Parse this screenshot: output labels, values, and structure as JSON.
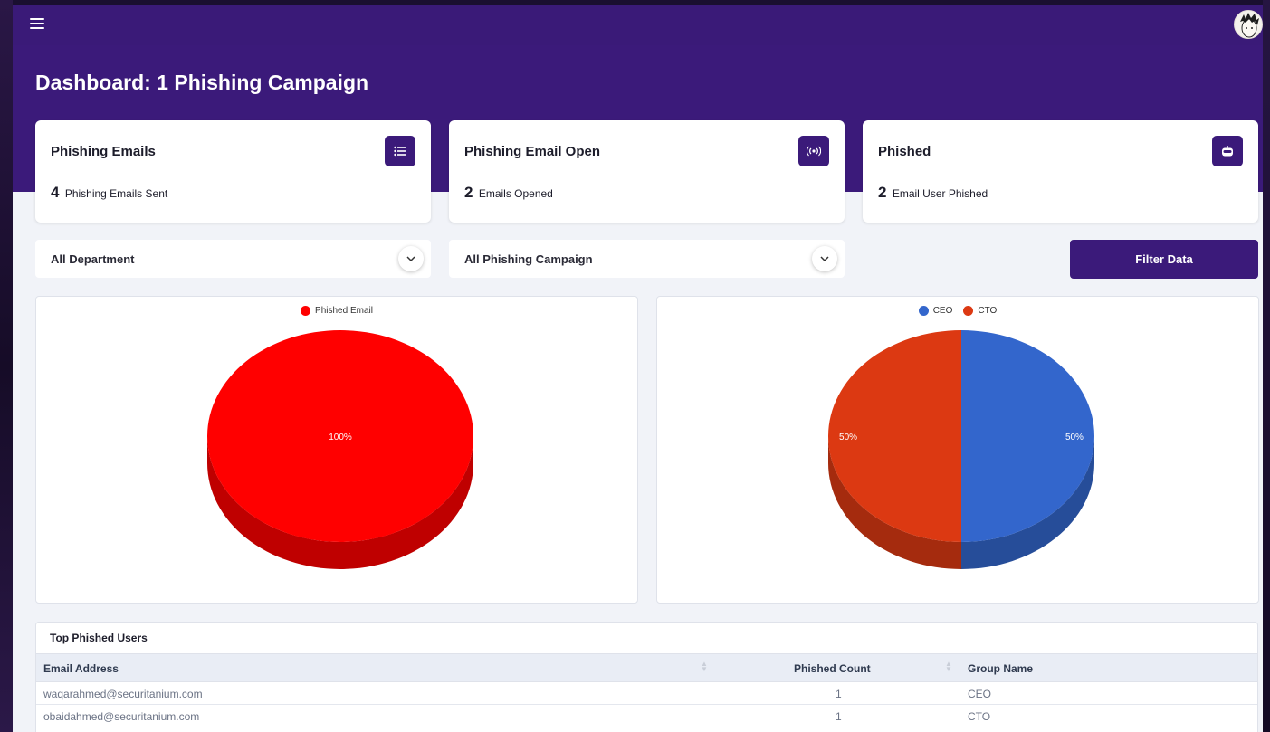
{
  "header": {
    "page_title": "Dashboard: 1 Phishing Campaign"
  },
  "cards": [
    {
      "title": "Phishing Emails",
      "value": "4",
      "label": "Phishing Emails Sent",
      "icon": "list-icon"
    },
    {
      "title": "Phishing Email Open",
      "value": "2",
      "label": "Emails Opened",
      "icon": "broadcast-icon"
    },
    {
      "title": "Phished",
      "value": "2",
      "label": "Email User Phished",
      "icon": "robot-icon"
    }
  ],
  "filters": {
    "department": "All Department",
    "campaign": "All Phishing Campaign",
    "filter_button": "Filter Data"
  },
  "colors": {
    "primary": "#3b1a7a",
    "phished": "#ff0000",
    "ceo": "#3366cc",
    "cto": "#dc3912"
  },
  "chart_data": [
    {
      "type": "pie",
      "legend": [
        "Phished Email"
      ],
      "slices": [
        {
          "name": "Phished Email",
          "value": 100,
          "label": "100%",
          "color": "#ff0000"
        }
      ]
    },
    {
      "type": "pie",
      "legend": [
        "CEO",
        "CTO"
      ],
      "slices": [
        {
          "name": "CEO",
          "value": 50,
          "label": "50%",
          "color": "#3366cc"
        },
        {
          "name": "CTO",
          "value": 50,
          "label": "50%",
          "color": "#dc3912"
        }
      ]
    }
  ],
  "table": {
    "title": "Top Phished Users",
    "columns": [
      "Email Address",
      "Phished Count",
      "Group Name"
    ],
    "rows": [
      [
        "waqarahmed@securitanium.com",
        "1",
        "CEO"
      ],
      [
        "obaidahmed@securitanium.com",
        "1",
        "CTO"
      ]
    ]
  }
}
